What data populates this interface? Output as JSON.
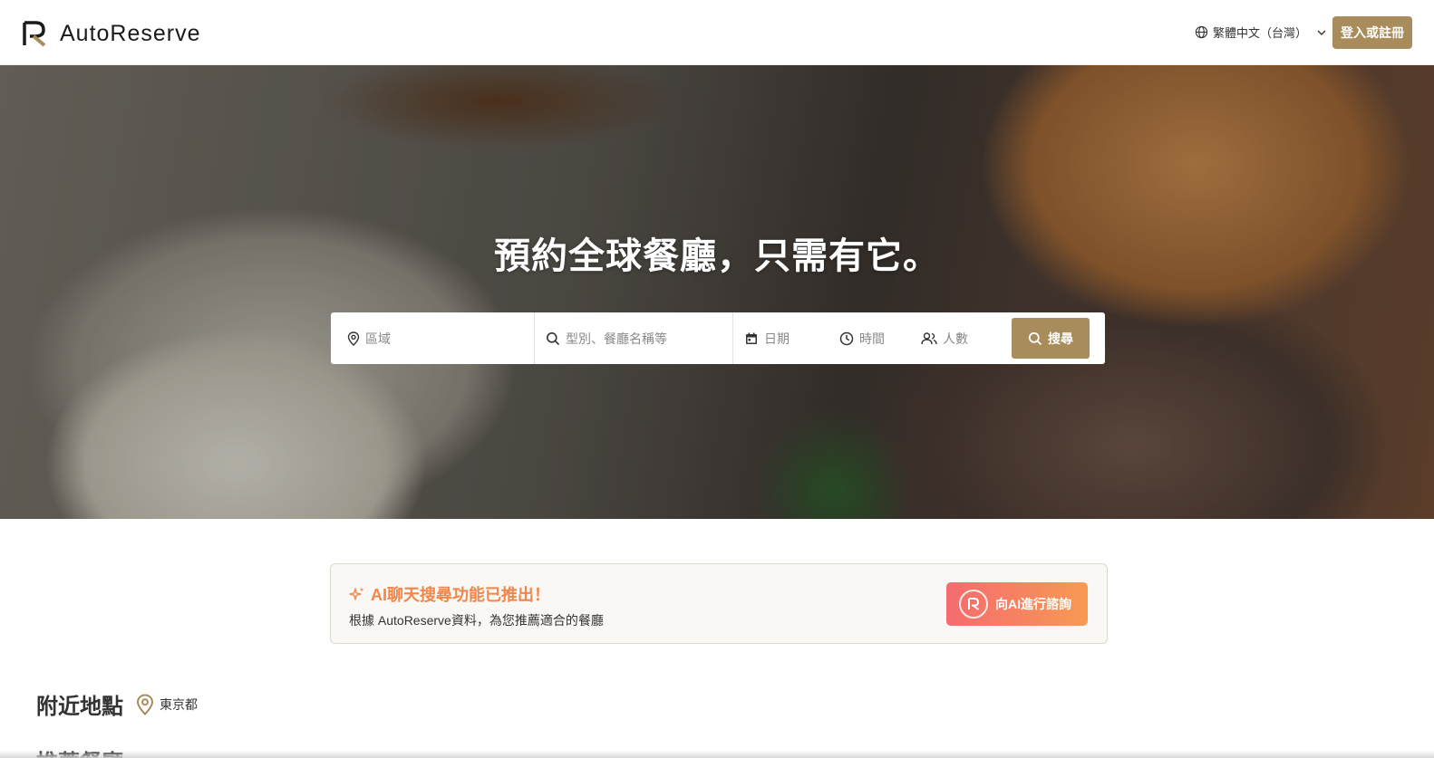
{
  "header": {
    "brand": "AutoReserve",
    "language": "繁體中文（台灣）",
    "login_label": "登入或註冊"
  },
  "hero": {
    "title": "預約全球餐廳，只需有它。"
  },
  "search": {
    "area_placeholder": "區域",
    "genre_placeholder": "型別、餐廳名稱等",
    "date_placeholder": "日期",
    "time_placeholder": "時間",
    "people_placeholder": "人數",
    "button_label": "搜尋"
  },
  "ai_banner": {
    "title": "AI聊天搜尋功能已推出！",
    "description": "根據 AutoReserve資料，為您推薦適合的餐廳",
    "button_label": "向AI進行諮詢"
  },
  "nearby": {
    "title": "附近地點",
    "location": "東京都"
  },
  "recommended": {
    "title": "推薦餐廳"
  },
  "colors": {
    "brand_gold": "#a98c5b",
    "ai_orange": "#f0864a",
    "ai_gradient_start": "#f56b70",
    "ai_gradient_end": "#f79a52"
  },
  "icons": {
    "logo": "autoreserve-logo-icon",
    "language": "globe-icon",
    "area": "map-pin-icon",
    "genre": "search-icon",
    "date": "calendar-icon",
    "time": "clock-icon",
    "people": "people-icon",
    "ai": "sparkle-icon",
    "location": "location-pin-icon"
  }
}
